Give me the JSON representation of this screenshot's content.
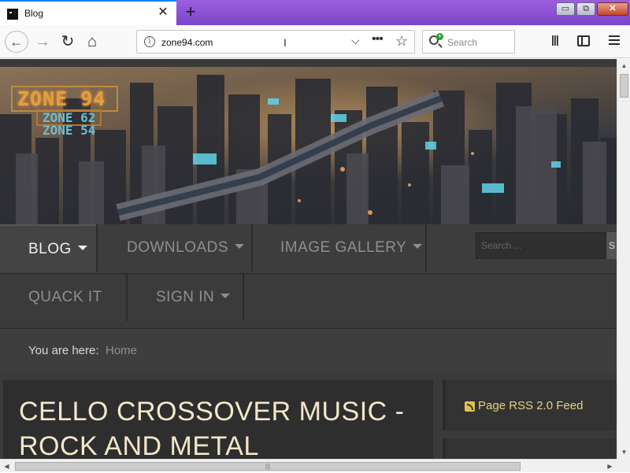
{
  "browser": {
    "tab": {
      "title": "Blog",
      "close_glyph": "✕"
    },
    "new_tab_glyph": "+",
    "window_controls": {
      "minimize": "▭",
      "maximize": "⧉",
      "close": "✕"
    },
    "nav": {
      "back_glyph": "←",
      "forward_glyph": "→",
      "reload_glyph": "↻",
      "home_glyph": "⌂"
    },
    "url": {
      "info_glyph": "i",
      "value": "zone94.com",
      "cursor_glyph": "I",
      "dropdown_glyph": "⌵",
      "more_glyph": "•••",
      "bookmark_glyph": "☆"
    },
    "search": {
      "placeholder": "Search"
    },
    "toolbar": {
      "library_glyph": "|||"
    }
  },
  "site": {
    "logo": {
      "line1": "ZONE 94",
      "line2": "ZONE 62",
      "line3": "ZONE 54"
    },
    "menu_row1": [
      {
        "label": "BLOG",
        "active": true
      },
      {
        "label": "DOWNLOADS",
        "active": false
      },
      {
        "label": "IMAGE GALLERY",
        "active": false
      }
    ],
    "menu_row2": [
      {
        "label": "QUACK IT"
      },
      {
        "label": "SIGN IN"
      }
    ],
    "search_placeholder": "Search ...",
    "search_button": "S",
    "breadcrumb": {
      "label": "You are here:",
      "home": "Home"
    },
    "article": {
      "title": "CELLO CROSSOVER MUSIC - ROCK AND METAL"
    },
    "sidebar": {
      "rss_label": "Page RSS 2.0 Feed"
    }
  },
  "scrollbars": {
    "up": "▲",
    "down": "▼",
    "left": "◀",
    "right": "▶",
    "grip": "|||"
  },
  "colors": {
    "tab_strip": "#8a4fd4",
    "accent": "#0a84ff",
    "article_title": "#f2e7c9",
    "rss_link": "#e6d27a"
  }
}
